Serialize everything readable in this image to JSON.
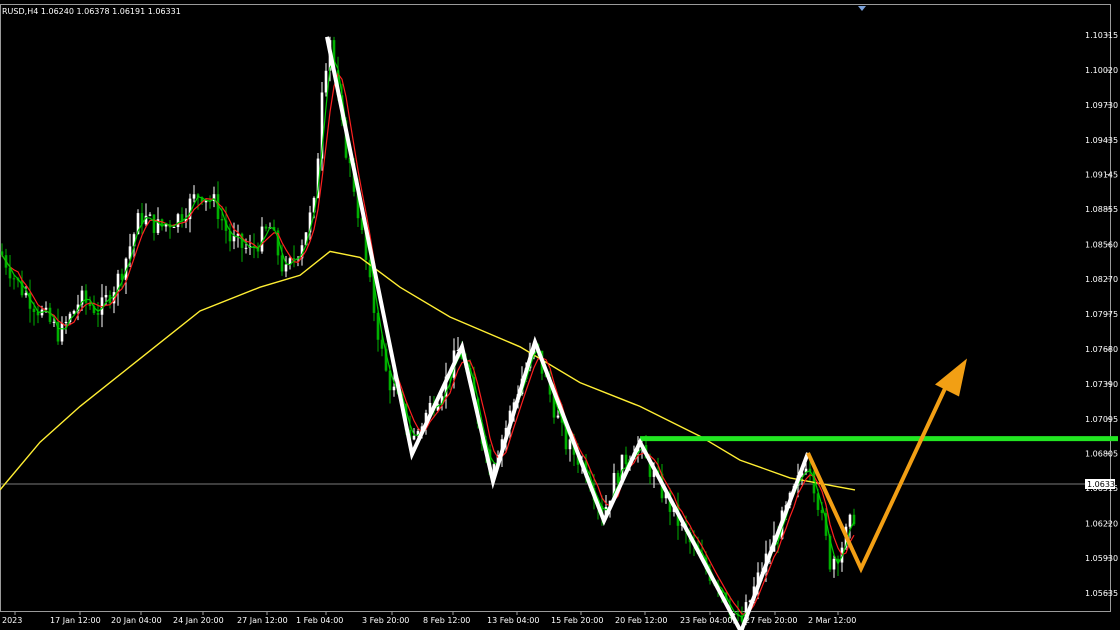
{
  "window": {
    "header_text": "RUSD,H4  1.06240 1.06378 1.06191 1.06331"
  },
  "colors": {
    "background": "#000000",
    "bull_candle": "#ffffff",
    "bear_candle": "#00b000",
    "ma_fast_a": "#00cc00",
    "ma_fast_b": "#ff2020",
    "ma_slow": "#ffee33",
    "zigzag": "#ffffff",
    "projection": "#f29f14",
    "resistance_line": "#22e622",
    "support_line": "#ee1c1c",
    "frame": "#9a9a9a"
  },
  "chart_data": {
    "type": "line",
    "symbol": "EURUSD",
    "timeframe": "H4",
    "y_ticks": [
      "1.10315",
      "1.10020",
      "1.09730",
      "1.09435",
      "1.09145",
      "1.08855",
      "1.08560",
      "1.08270",
      "1.07975",
      "1.07680",
      "1.07390",
      "1.07095",
      "1.06805",
      "1.06515",
      "1.06220",
      "1.05930",
      "1.05635"
    ],
    "ylim": [
      1.0532,
      1.1046
    ],
    "x_ticks": [
      "2023",
      "17 Jan 12:00",
      "20 Jan 04:00",
      "24 Jan 20:00",
      "27 Jan 12:00",
      "1 Feb 04:00",
      "3 Feb 20:00",
      "8 Feb 12:00",
      "13 Feb 04:00",
      "15 Feb 20:00",
      "20 Feb 12:00",
      "23 Feb 04:00",
      "27 Feb 20:00",
      "2 Mar 12:00"
    ],
    "current_price": "1.06331",
    "zigzag": [
      {
        "t": "1 Feb 04:00",
        "price": 1.103
      },
      {
        "t": "8 Feb 12:00",
        "price": 1.068
      },
      {
        "t": "8 Feb 12:00",
        "price": 1.077
      },
      {
        "t": "13 Feb 04:00",
        "price": 1.0657
      },
      {
        "t": "13 Feb 04:00",
        "price": 1.0774
      },
      {
        "t": "15 Feb 20:00",
        "price": 1.0624
      },
      {
        "t": "20 Feb 12:00",
        "price": 1.069
      },
      {
        "t": "23 Feb 04:00",
        "price": 1.0531
      },
      {
        "t": "27 Feb 20:00",
        "price": 1.0681
      }
    ],
    "projection": [
      {
        "t": "27 Feb 20:00",
        "price": 1.0681
      },
      {
        "t": "2 Mar 12:00",
        "price": 1.0584
      },
      {
        "t": "after 2 Mar 12:00",
        "price": 1.0735
      }
    ],
    "resistance_level": 1.0693,
    "support_level": 1.0531,
    "moving_averages": [
      {
        "color": "#ffee33"
      },
      {
        "color": "#00cc00"
      },
      {
        "color": "#ff2020"
      }
    ]
  }
}
